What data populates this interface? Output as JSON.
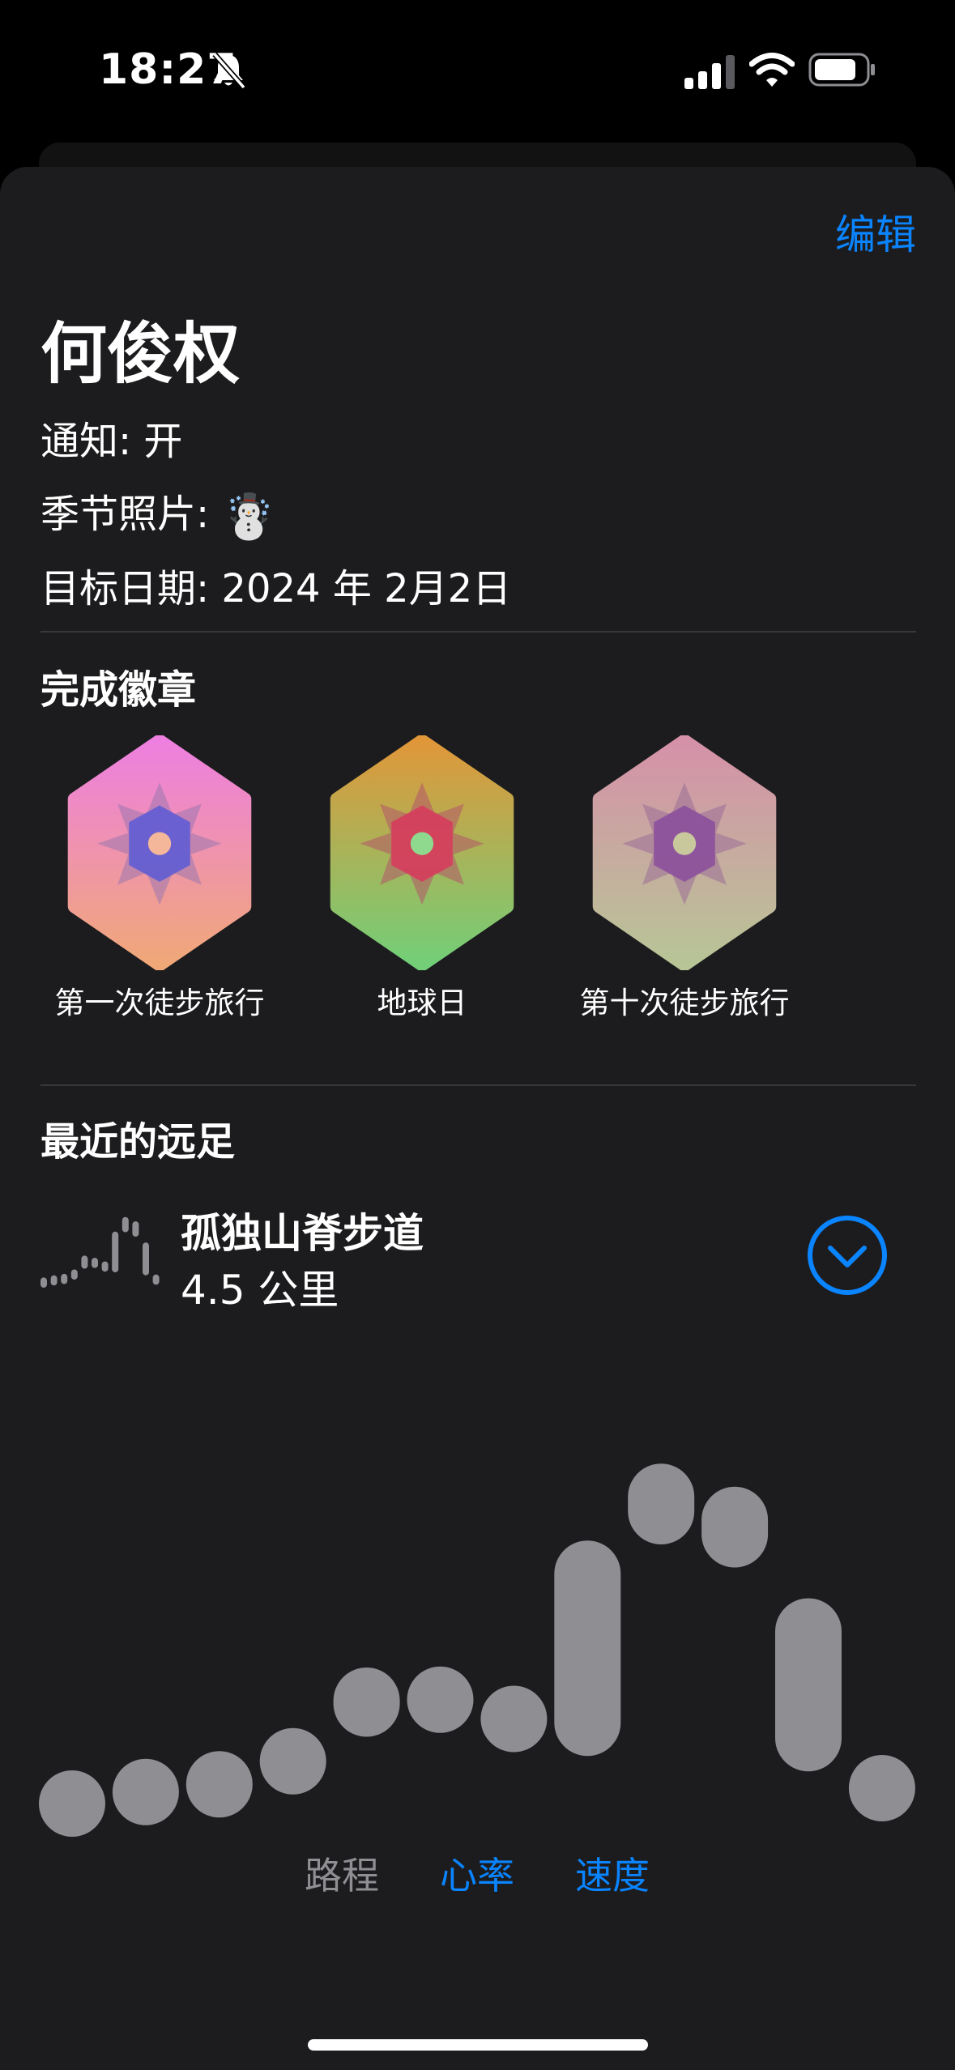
{
  "status_bar": {
    "time": "18:27",
    "icons": [
      "bell-slash-icon",
      "cellular-signal-icon",
      "wifi-icon",
      "battery-icon"
    ]
  },
  "header": {
    "edit_label": "编辑"
  },
  "profile": {
    "name": "何俊权",
    "notifications": "通知: 开",
    "season_photo_label": "季节照片:",
    "season_photo_emoji": "☃️",
    "goal_date": "目标日期: 2024 年 2月2日"
  },
  "badges": {
    "title": "完成徽章",
    "items": [
      {
        "label": "第一次徒步旅行",
        "top_color": "#ee7fe0",
        "bottom_color": "#f0a878",
        "center_color": "#5a5ad6"
      },
      {
        "label": "地球日",
        "top_color": "#e0973a",
        "bottom_color": "#72cf78",
        "center_color": "#d8385c"
      },
      {
        "label": "第十次徒步旅行",
        "top_color": "#d591a8",
        "bottom_color": "#b8c596",
        "center_color": "#8a4c9c"
      }
    ]
  },
  "recent": {
    "title": "最近的远足",
    "hike": {
      "name": "孤独山脊步道",
      "distance": "4.5 公里",
      "expand_icon": "chevron-down-circle-icon"
    }
  },
  "chart_data": {
    "type": "bar",
    "series": [
      {
        "ranges": [
          [
            0.0,
            0.14
          ],
          [
            0.03,
            0.17
          ],
          [
            0.05,
            0.19
          ],
          [
            0.11,
            0.25
          ],
          [
            0.26,
            0.44
          ],
          [
            0.27,
            0.41
          ],
          [
            0.22,
            0.36
          ],
          [
            0.21,
            0.77
          ],
          [
            0.76,
            0.97
          ],
          [
            0.7,
            0.91
          ],
          [
            0.17,
            0.62
          ],
          [
            0.04,
            0.18
          ]
        ]
      }
    ],
    "bar_color": "#8e8e93"
  },
  "tabs": [
    "路程",
    "心率",
    "速度"
  ]
}
